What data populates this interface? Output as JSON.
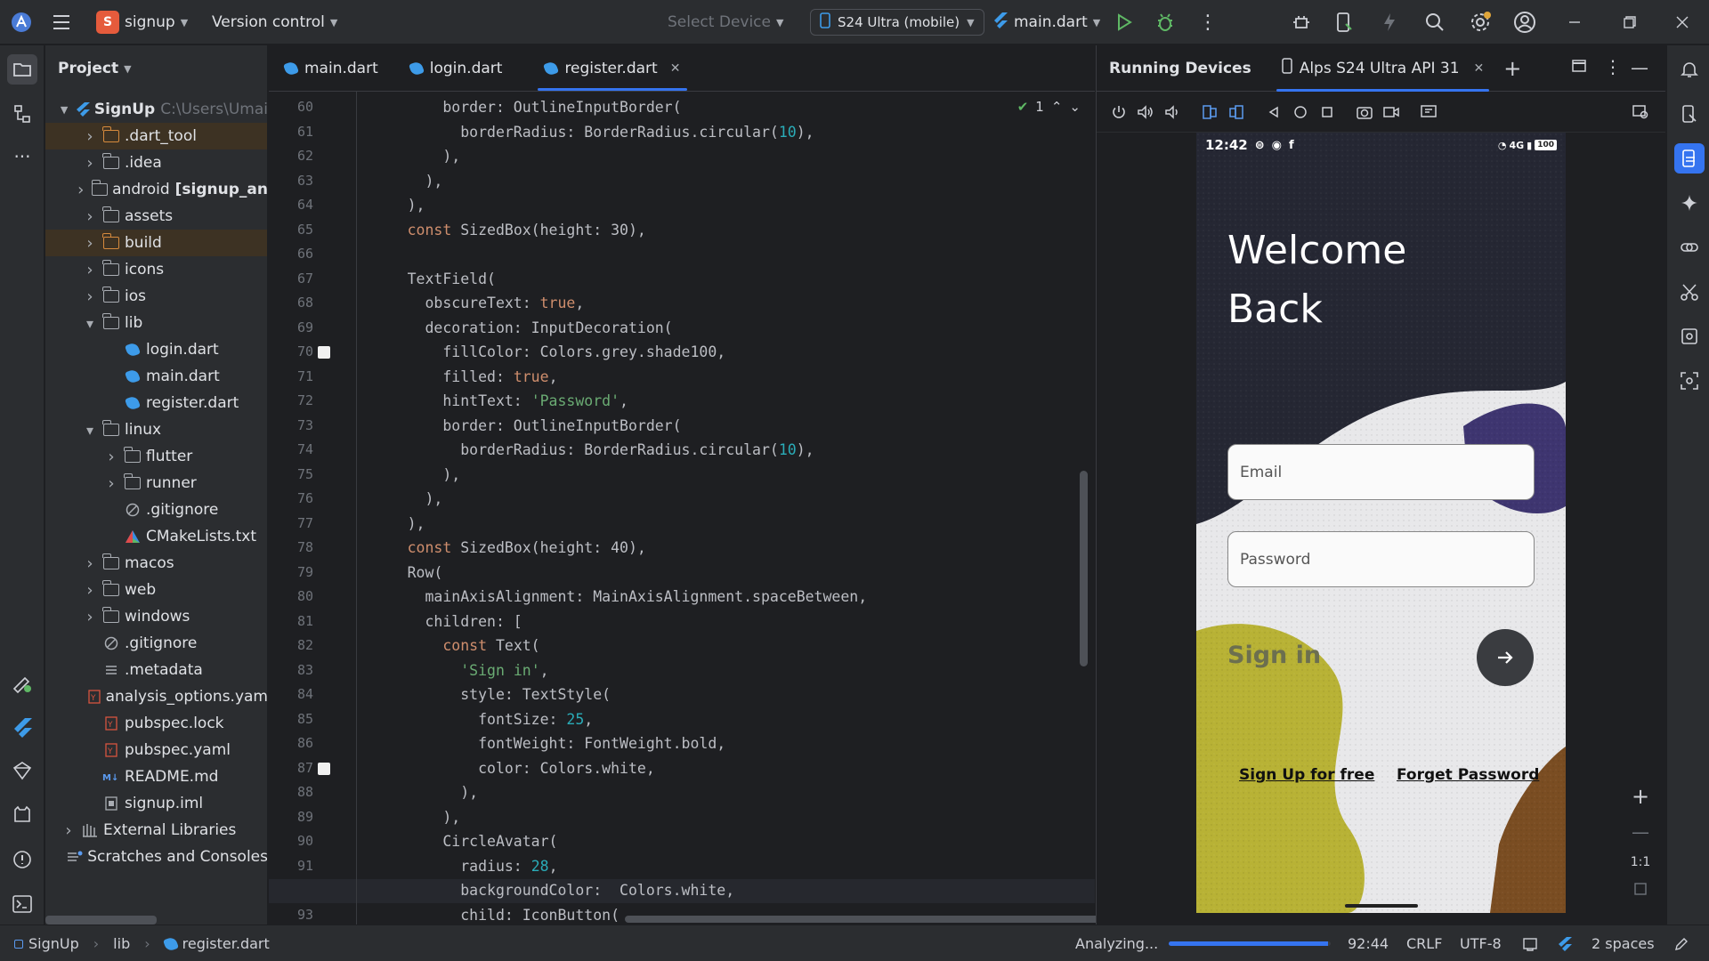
{
  "titlebar": {
    "project_initial": "S",
    "project_name": "signup",
    "vcs": "Version control",
    "select_device": "Select Device",
    "device": "S24 Ultra (mobile)",
    "run_config": "main.dart"
  },
  "project_panel": {
    "title": "Project",
    "root_name": "SignUp",
    "root_path": "C:\\Users\\Umai",
    "items": [
      {
        "label": ".dart_tool",
        "indent": 1,
        "type": "folder-orange",
        "expander": "closed"
      },
      {
        "label": ".idea",
        "indent": 1,
        "type": "folder",
        "expander": "closed"
      },
      {
        "label": "android",
        "suffix": "[signup_an",
        "indent": 1,
        "type": "folder",
        "expander": "closed"
      },
      {
        "label": "assets",
        "indent": 1,
        "type": "folder",
        "expander": "closed"
      },
      {
        "label": "build",
        "indent": 1,
        "type": "folder-orange",
        "expander": "closed"
      },
      {
        "label": "icons",
        "indent": 1,
        "type": "folder",
        "expander": "closed"
      },
      {
        "label": "ios",
        "indent": 1,
        "type": "folder",
        "expander": "closed"
      },
      {
        "label": "lib",
        "indent": 1,
        "type": "folder",
        "expander": "open"
      },
      {
        "label": "login.dart",
        "indent": 2,
        "type": "dart",
        "expander": "none"
      },
      {
        "label": "main.dart",
        "indent": 2,
        "type": "dart",
        "expander": "none"
      },
      {
        "label": "register.dart",
        "indent": 2,
        "type": "dart",
        "expander": "none"
      },
      {
        "label": "linux",
        "indent": 1,
        "type": "folder",
        "expander": "open"
      },
      {
        "label": "flutter",
        "indent": 2,
        "type": "folder",
        "expander": "closed"
      },
      {
        "label": "runner",
        "indent": 2,
        "type": "folder",
        "expander": "closed"
      },
      {
        "label": ".gitignore",
        "indent": 2,
        "type": "ignore",
        "expander": "none"
      },
      {
        "label": "CMakeLists.txt",
        "indent": 2,
        "type": "cmake",
        "expander": "none"
      },
      {
        "label": "macos",
        "indent": 1,
        "type": "folder",
        "expander": "closed"
      },
      {
        "label": "web",
        "indent": 1,
        "type": "folder",
        "expander": "closed"
      },
      {
        "label": "windows",
        "indent": 1,
        "type": "folder",
        "expander": "closed"
      },
      {
        "label": ".gitignore",
        "indent": 1,
        "type": "ignore",
        "expander": "none"
      },
      {
        "label": ".metadata",
        "indent": 1,
        "type": "text",
        "expander": "none"
      },
      {
        "label": "analysis_options.yam",
        "indent": 1,
        "type": "yaml",
        "expander": "none"
      },
      {
        "label": "pubspec.lock",
        "indent": 1,
        "type": "yaml",
        "expander": "none"
      },
      {
        "label": "pubspec.yaml",
        "indent": 1,
        "type": "yaml",
        "expander": "none"
      },
      {
        "label": "README.md",
        "indent": 1,
        "type": "md",
        "expander": "none"
      },
      {
        "label": "signup.iml",
        "indent": 1,
        "type": "iml",
        "expander": "none"
      },
      {
        "label": "External Libraries",
        "indent": 0,
        "type": "lib",
        "expander": "closed"
      },
      {
        "label": "Scratches and Consoles",
        "indent": 0,
        "type": "scratch",
        "expander": "none"
      }
    ]
  },
  "editor": {
    "tabs": [
      {
        "label": "main.dart",
        "active": false
      },
      {
        "label": "login.dart",
        "active": false
      },
      {
        "label": "register.dart",
        "active": true
      }
    ],
    "problems_count": "1",
    "lines": [
      {
        "n": "60",
        "text": "          border: OutlineInputBorder("
      },
      {
        "n": "61",
        "text": "            borderRadius: BorderRadius.circular(10),"
      },
      {
        "n": "62",
        "text": "          ),"
      },
      {
        "n": "63",
        "text": "        ),"
      },
      {
        "n": "64",
        "text": "      ),"
      },
      {
        "n": "65",
        "text": "      const SizedBox(height: 30),"
      },
      {
        "n": "66",
        "text": ""
      },
      {
        "n": "67",
        "text": "      TextField("
      },
      {
        "n": "68",
        "text": "        obscureText: true,"
      },
      {
        "n": "69",
        "text": "        decoration: InputDecoration("
      },
      {
        "n": "70",
        "text": "          fillColor: Colors.grey.shade100,"
      },
      {
        "n": "71",
        "text": "          filled: true,"
      },
      {
        "n": "72",
        "text": "          hintText: 'Password',"
      },
      {
        "n": "73",
        "text": "          border: OutlineInputBorder("
      },
      {
        "n": "74",
        "text": "            borderRadius: BorderRadius.circular(10),"
      },
      {
        "n": "75",
        "text": "          ),"
      },
      {
        "n": "76",
        "text": "        ),"
      },
      {
        "n": "77",
        "text": "      ),"
      },
      {
        "n": "78",
        "text": "      const SizedBox(height: 40),"
      },
      {
        "n": "79",
        "text": "      Row("
      },
      {
        "n": "80",
        "text": "        mainAxisAlignment: MainAxisAlignment.spaceBetween,"
      },
      {
        "n": "81",
        "text": "        children: ["
      },
      {
        "n": "82",
        "text": "          const Text("
      },
      {
        "n": "83",
        "text": "            'Sign in',"
      },
      {
        "n": "84",
        "text": "            style: TextStyle("
      },
      {
        "n": "85",
        "text": "              fontSize: 25,"
      },
      {
        "n": "86",
        "text": "              fontWeight: FontWeight.bold,"
      },
      {
        "n": "87",
        "text": "              color: Colors.white,"
      },
      {
        "n": "88",
        "text": "            ),"
      },
      {
        "n": "89",
        "text": "          ),"
      },
      {
        "n": "90",
        "text": "          CircleAvatar("
      },
      {
        "n": "91",
        "text": "            radius: 28,"
      },
      {
        "n": "92",
        "text": "            backgroundColor:  Colors.white,"
      },
      {
        "n": "93",
        "text": "            child: IconButton("
      }
    ]
  },
  "devices": {
    "panel_title": "Running Devices",
    "device_tab": "Alps S24 Ultra API 31",
    "phone": {
      "time": "12:42",
      "network": "4G",
      "battery": "100",
      "welcome_line1": "Welcome",
      "welcome_line2": "Back",
      "email_hint": "Email",
      "password_hint": "Password",
      "signin": "Sign in",
      "signup_link": "Sign Up for free",
      "forget_link": "Forget Password"
    },
    "zoom_label": "1:1"
  },
  "statusbar": {
    "crumbs": [
      "SignUp",
      "lib",
      "register.dart"
    ],
    "analyzing": "Analyzing...",
    "progress": 0.98,
    "position": "92:44",
    "line_sep": "CRLF",
    "encoding": "UTF-8",
    "indent": "2 spaces"
  },
  "colors": {
    "accent": "#3574f0",
    "keyword": "#cf8e6d",
    "string": "#6aab73",
    "number": "#2aacb8"
  }
}
